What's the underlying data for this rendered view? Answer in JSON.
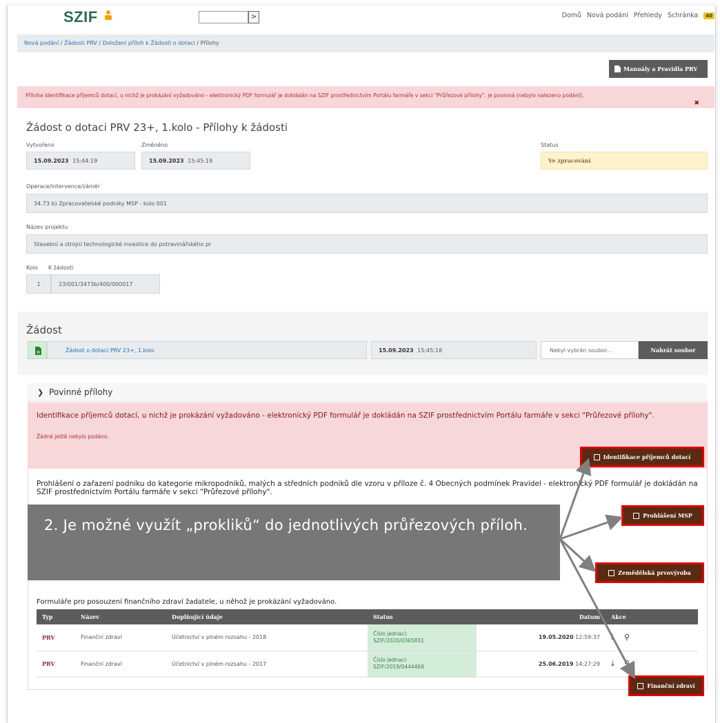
{
  "header": {
    "logo_text": "SZIF",
    "search_button": ">",
    "nav": [
      "Domů",
      "Nová podání",
      "Přehledy",
      "Schránka"
    ],
    "inbox_count": "40"
  },
  "breadcrumb": [
    "Nová podání",
    "Žádosti PRV",
    "Doložení příloh k Žádosti o dotaci",
    "Přílohy"
  ],
  "manuals_button": "Manuály a Pravidla PRV",
  "alert_text": "Příloha Identifikace příjemců dotací, u nichž je prokázání vyžadováno - elektronický PDF formulář je dokládán na SZIF prostřednictvím Portálu farmáře v sekci \"Průřezové přílohy\". je povinná (nebylo nalezeno podání).",
  "page_title": "Žádost o dotaci PRV 23+, 1.kolo - Přílohy k žádosti",
  "created": {
    "label": "Vytvořeno",
    "date": "15.09.2023",
    "time": "15:44:19"
  },
  "changed": {
    "label": "Změněno",
    "date": "15.09.2023",
    "time": "15:45:19"
  },
  "status": {
    "label": "Status",
    "value": "Ve zpracování"
  },
  "operation": {
    "label": "Operace/intervence/záměr",
    "value": "34.73 b) Zpracovatelské podniky MSP - kolo 001"
  },
  "project": {
    "label": "Název projektu",
    "value": "Stavební a strojní technologické investice do potravinářského pr"
  },
  "round": {
    "label": "Kolo",
    "value": "1"
  },
  "to_request": {
    "label": "K žádosti",
    "value": "23/001/3473b/400/000017"
  },
  "zadost": {
    "heading": "Žádost",
    "doc_link": "Žádost o dotaci PRV 23+, 1.kolo",
    "date": "15.09.2023",
    "time": "15:45:18",
    "file_placeholder": "Nebyl vybrán soubor...",
    "upload_button": "Nahrát soubor"
  },
  "mandatory": {
    "heading": "Povinné přílohy",
    "item1_title": "Identifikace příjemců dotací, u nichž je prokázání vyžadováno - elektronický PDF formulář je dokládán na SZIF prostřednictvím Portálu farmáře v sekci \"Průřezové přílohy\".",
    "item1_sub": "Žádné ještě nebylo podáno.",
    "item1_button": "Identifikace příjemců dotací",
    "item2_title": "Prohlášení o zařazení podniku do kategorie mikropodniků, malých a středních podniků dle vzoru v příloze č. 4 Obecných podmínek Pravidel - elektronický PDF formulář je dokládán na SZIF prostřednictvím Portálu farmáře v sekci \"Průřezové přílohy\".",
    "item2_button": "Prohlášení MSP",
    "item3_button": "Zemědělská prvovýroba",
    "overlay_text": "2. Je možné využít „prokliků“ do jednotlivých průřezových příloh."
  },
  "financial": {
    "title": "Formuláře pro posouzení finančního zdraví žadatele, u něhož je prokázání vyžadováno.",
    "columns": [
      "Typ",
      "Název",
      "Doplňující údaje",
      "Status",
      "Datum",
      "Akce"
    ],
    "rows": [
      {
        "typ": "PRV",
        "nazev": "Finanční zdraví",
        "udaje": "Účetnictví v plném rozsahu - 2018",
        "status_l1": "Číslo jednací:",
        "status_l2": "SZIF/2020/0365831",
        "date": "19.05.2020",
        "time": "12:59:37"
      },
      {
        "typ": "PRV",
        "nazev": "Finanční zdraví",
        "udaje": "Účetnictví v plném rozsahu - 2017",
        "status_l1": "Číslo jednací:",
        "status_l2": "SZIF/2019/0444469",
        "date": "25.06.2019",
        "time": "14:27:29"
      }
    ],
    "button": "Finanční zdraví"
  }
}
